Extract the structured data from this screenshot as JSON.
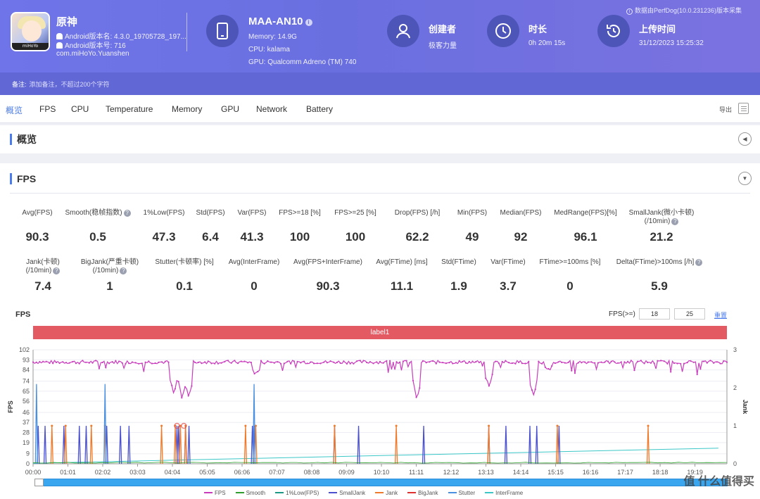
{
  "header": {
    "app_name": "原神",
    "app_icon_tag": "miHoYo",
    "android_pkg_name": "Android版本名: 4.3.0_19705728_197...",
    "android_version_code": "Android版本号: 716",
    "package": "com.miHoYo.Yuanshen",
    "device_name": "MAA-AN10",
    "memory": "Memory: 14.9G",
    "cpu": "CPU: kalama",
    "gpu": "GPU: Qualcomm Adreno (TM) 740",
    "creator_title": "创建者",
    "creator_value": "极客力量",
    "duration_title": "时长",
    "duration_value": "0h 20m 15s",
    "upload_title": "上传时间",
    "upload_value": "31/12/2023 15:25:32",
    "collect_note": "数据由PerfDog(10.0.231236)版本采集",
    "notes_label": "备注:",
    "notes_placeholder": "添加备注，不超过200个字符"
  },
  "tabs": [
    "概览",
    "FPS",
    "CPU",
    "Temperature",
    "Memory",
    "GPU",
    "Network",
    "Battery"
  ],
  "export_label": "导出",
  "overview_title": "概览",
  "fps_title": "FPS",
  "metrics_row1": [
    {
      "label": "Avg(FPS)",
      "value": "90.3"
    },
    {
      "label": "Smooth(稳帧指数)",
      "value": "0.5"
    },
    {
      "label": "1%Low(FPS)",
      "value": "47.3"
    },
    {
      "label": "Std(FPS)",
      "value": "6.4"
    },
    {
      "label": "Var(FPS)",
      "value": "41.3"
    },
    {
      "label": "FPS>=18 [%]",
      "value": "100"
    },
    {
      "label": "FPS>=25 [%]",
      "value": "100"
    },
    {
      "label": "Drop(FPS) [/h]",
      "value": "62.2"
    },
    {
      "label": "Min(FPS)",
      "value": "49"
    },
    {
      "label": "Median(FPS)",
      "value": "92"
    },
    {
      "label": "MedRange(FPS)[%]",
      "value": "96.1"
    },
    {
      "label": "SmallJank(微小卡顿)",
      "label2": "(/10min)",
      "value": "21.2"
    }
  ],
  "metrics_row2": [
    {
      "label": "Jank(卡顿)",
      "label2": "(/10min)",
      "value": "7.4"
    },
    {
      "label": "BigJank(严重卡顿)",
      "label2": "(/10min)",
      "value": "1"
    },
    {
      "label": "Stutter(卡顿率) [%]",
      "value": "0.1"
    },
    {
      "label": "Avg(InterFrame)",
      "value": "0"
    },
    {
      "label": "Avg(FPS+InterFrame)",
      "value": "90.3"
    },
    {
      "label": "Avg(FTime) [ms]",
      "value": "11.1"
    },
    {
      "label": "Std(FTime)",
      "value": "1.9"
    },
    {
      "label": "Var(FTime)",
      "value": "3.7"
    },
    {
      "label": "FTime>=100ms [%]",
      "value": "0"
    },
    {
      "label": "Delta(FTime)>100ms [/h]",
      "value": "5.9"
    }
  ],
  "chart_controls": {
    "chart_label": "FPS",
    "threshold_label": "FPS(>=)",
    "threshold_a": "18",
    "threshold_b": "25",
    "reset_label": "重置",
    "band_label": "label1"
  },
  "legend": [
    {
      "name": "FPS",
      "color": "#c93dbd"
    },
    {
      "name": "Smooth",
      "color": "#2ca02c"
    },
    {
      "name": "1%Low(FPS)",
      "color": "#1a9a84"
    },
    {
      "name": "SmallJank",
      "color": "#4a50d0"
    },
    {
      "name": "Jank",
      "color": "#f07a2a"
    },
    {
      "name": "BigJank",
      "color": "#e03030"
    },
    {
      "name": "Stutter",
      "color": "#4a90e2"
    },
    {
      "name": "InterFrame",
      "color": "#3cc7c7"
    }
  ],
  "watermark": "值 什么值得买",
  "chart_data": {
    "type": "line",
    "ylabel": "FPS",
    "y2label": "Jank",
    "ylim": [
      0,
      102
    ],
    "yticks": [
      0,
      9,
      19,
      28,
      37,
      46,
      56,
      65,
      74,
      84,
      93,
      102
    ],
    "y2lim": [
      0,
      3
    ],
    "y2ticks": [
      0,
      1,
      2,
      3
    ],
    "xticks": [
      "00:00",
      "01:01",
      "02:02",
      "03:03",
      "04:04",
      "05:05",
      "06:06",
      "07:07",
      "08:08",
      "09:09",
      "10:10",
      "11:11",
      "12:12",
      "13:13",
      "14:14",
      "15:15",
      "16:16",
      "17:17",
      "18:18",
      "19:19"
    ],
    "fps_series": {
      "baseline": 91,
      "dips": [
        {
          "t": 4.1,
          "min": 63
        },
        {
          "t": 4.35,
          "min": 58
        },
        {
          "t": 4.55,
          "min": 60
        },
        {
          "t": 6.5,
          "min": 80
        },
        {
          "t": 11.2,
          "min": 58
        },
        {
          "t": 13.3,
          "min": 70
        },
        {
          "t": 14.6,
          "min": 60
        },
        {
          "t": 15.05,
          "min": 84
        }
      ]
    },
    "small_jank_minutes": [
      0.15,
      0.35,
      0.9,
      1.35,
      1.55,
      2.15,
      2.55,
      2.8,
      4.2,
      4.25,
      4.45,
      4.55,
      6.4,
      6.45,
      8.8,
      9.5,
      11.4,
      13.3,
      13.8,
      14.5,
      14.7,
      15.35
    ],
    "jank_minutes": [
      0.55,
      0.95,
      1.7,
      2.1,
      3.75,
      4.15,
      4.3,
      4.45,
      6.2,
      6.5,
      8.8,
      10.6,
      13.3,
      15.3,
      17.95
    ],
    "bigjank_minutes": [
      4.2,
      4.4
    ],
    "stutter_minutes": [
      0.1,
      2.1,
      6.45
    ],
    "interframe_trend": [
      [
        0,
        0.5
      ],
      [
        20,
        14
      ]
    ]
  }
}
